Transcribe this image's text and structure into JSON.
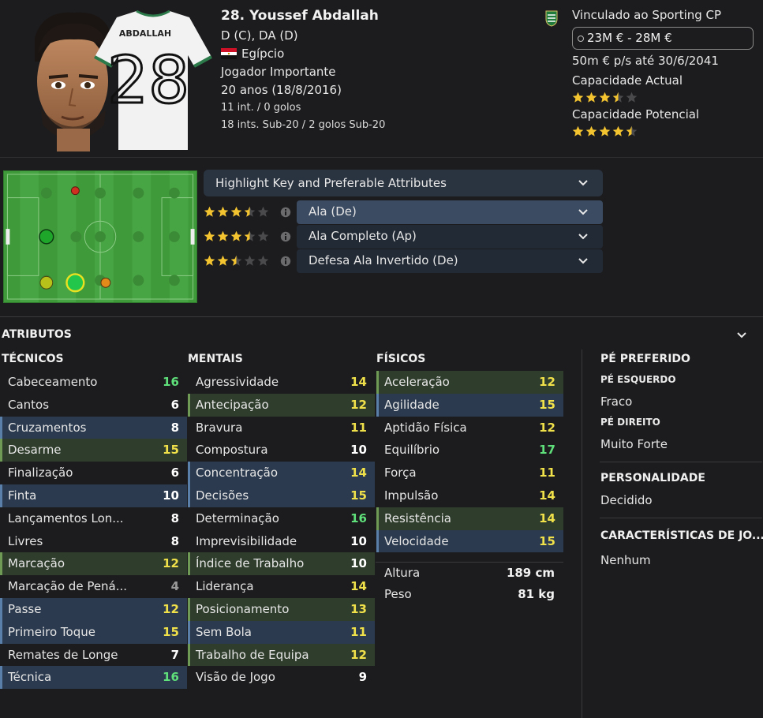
{
  "player": {
    "name": "28. Youssef Abdallah",
    "positions": "D (C), DA (D)",
    "nationality": "Egípcio",
    "role_status": "Jogador Importante",
    "age": "20 anos (18/8/2016)",
    "caps": "11 int. / 0 golos",
    "u20_caps": "18 ints. Sub-20 / 2 golos Sub-20",
    "shirt_name": "ABDALLAH",
    "shirt_number": "28"
  },
  "club": {
    "contract": "Vinculado ao Sporting CP",
    "value": "23M € - 28M €",
    "wage": "50m € p/s até 30/6/2041",
    "current_ability_label": "Capacidade Actual",
    "current_ability_stars": 3.5,
    "potential_ability_label": "Capacidade Potencial",
    "potential_ability_stars": 4.5
  },
  "roles": {
    "highlight_label": "Highlight Key and Preferable Attributes",
    "items": [
      {
        "label": "Ala (De)",
        "stars": 3.5,
        "active": true
      },
      {
        "label": "Ala Completo (Ap)",
        "stars": 3.5,
        "active": false
      },
      {
        "label": "Defesa Ala Invertido (De)",
        "stars": 2.5,
        "active": false
      }
    ]
  },
  "attributes": {
    "title": "ATRIBUTOS",
    "technical": {
      "title": "TÉCNICOS",
      "items": [
        {
          "label": "Cabeceamento",
          "value": 16,
          "hl": ""
        },
        {
          "label": "Cantos",
          "value": 6,
          "hl": ""
        },
        {
          "label": "Cruzamentos",
          "value": 8,
          "hl": "key"
        },
        {
          "label": "Desarme",
          "value": 15,
          "hl": "pref"
        },
        {
          "label": "Finalização",
          "value": 6,
          "hl": ""
        },
        {
          "label": "Finta",
          "value": 10,
          "hl": "key"
        },
        {
          "label": "Lançamentos Lon...",
          "value": 8,
          "hl": ""
        },
        {
          "label": "Livres",
          "value": 8,
          "hl": ""
        },
        {
          "label": "Marcação",
          "value": 12,
          "hl": "pref"
        },
        {
          "label": "Marcação de Pená...",
          "value": 4,
          "hl": ""
        },
        {
          "label": "Passe",
          "value": 12,
          "hl": "key"
        },
        {
          "label": "Primeiro Toque",
          "value": 15,
          "hl": "key"
        },
        {
          "label": "Remates de Longe",
          "value": 7,
          "hl": ""
        },
        {
          "label": "Técnica",
          "value": 16,
          "hl": "key"
        }
      ]
    },
    "mental": {
      "title": "MENTAIS",
      "items": [
        {
          "label": "Agressividade",
          "value": 14,
          "hl": ""
        },
        {
          "label": "Antecipação",
          "value": 12,
          "hl": "pref"
        },
        {
          "label": "Bravura",
          "value": 11,
          "hl": ""
        },
        {
          "label": "Compostura",
          "value": 10,
          "hl": ""
        },
        {
          "label": "Concentração",
          "value": 14,
          "hl": "key"
        },
        {
          "label": "Decisões",
          "value": 15,
          "hl": "key"
        },
        {
          "label": "Determinação",
          "value": 16,
          "hl": ""
        },
        {
          "label": "Imprevisibilidade",
          "value": 10,
          "hl": ""
        },
        {
          "label": "Índice de Trabalho",
          "value": 10,
          "hl": "pref"
        },
        {
          "label": "Liderança",
          "value": 14,
          "hl": ""
        },
        {
          "label": "Posicionamento",
          "value": 13,
          "hl": "pref"
        },
        {
          "label": "Sem Bola",
          "value": 11,
          "hl": "key"
        },
        {
          "label": "Trabalho de Equipa",
          "value": 12,
          "hl": "pref"
        },
        {
          "label": "Visão de Jogo",
          "value": 9,
          "hl": ""
        }
      ]
    },
    "physical": {
      "title": "FÍSICOS",
      "items": [
        {
          "label": "Aceleração",
          "value": 12,
          "hl": "pref"
        },
        {
          "label": "Agilidade",
          "value": 15,
          "hl": "key"
        },
        {
          "label": "Aptidão Física",
          "value": 12,
          "hl": ""
        },
        {
          "label": "Equilíbrio",
          "value": 17,
          "hl": ""
        },
        {
          "label": "Força",
          "value": 11,
          "hl": ""
        },
        {
          "label": "Impulsão",
          "value": 14,
          "hl": ""
        },
        {
          "label": "Resistência",
          "value": 14,
          "hl": "pref"
        },
        {
          "label": "Velocidade",
          "value": 15,
          "hl": "key"
        }
      ]
    },
    "height_label": "Altura",
    "height": "189 cm",
    "weight_label": "Peso",
    "weight": "81 kg"
  },
  "side": {
    "preferred_foot_title": "PÉ PREFERIDO",
    "left_foot_label": "PÉ ESQUERDO",
    "left_foot_value": "Fraco",
    "right_foot_label": "PÉ DIREITO",
    "right_foot_value": "Muito Forte",
    "personality_title": "PERSONALIDADE",
    "personality_value": "Decidido",
    "traits_title": "CARACTERÍSTICAS DE JO...",
    "traits_value": "Nenhum"
  },
  "colors": {
    "value_high": "#5fe07a",
    "value_mid": "#f0e04a",
    "value_low": "#ffffff",
    "value_very_low": "#9a9a9a",
    "star": "#f4c430",
    "star_empty": "#4a4a4c"
  }
}
